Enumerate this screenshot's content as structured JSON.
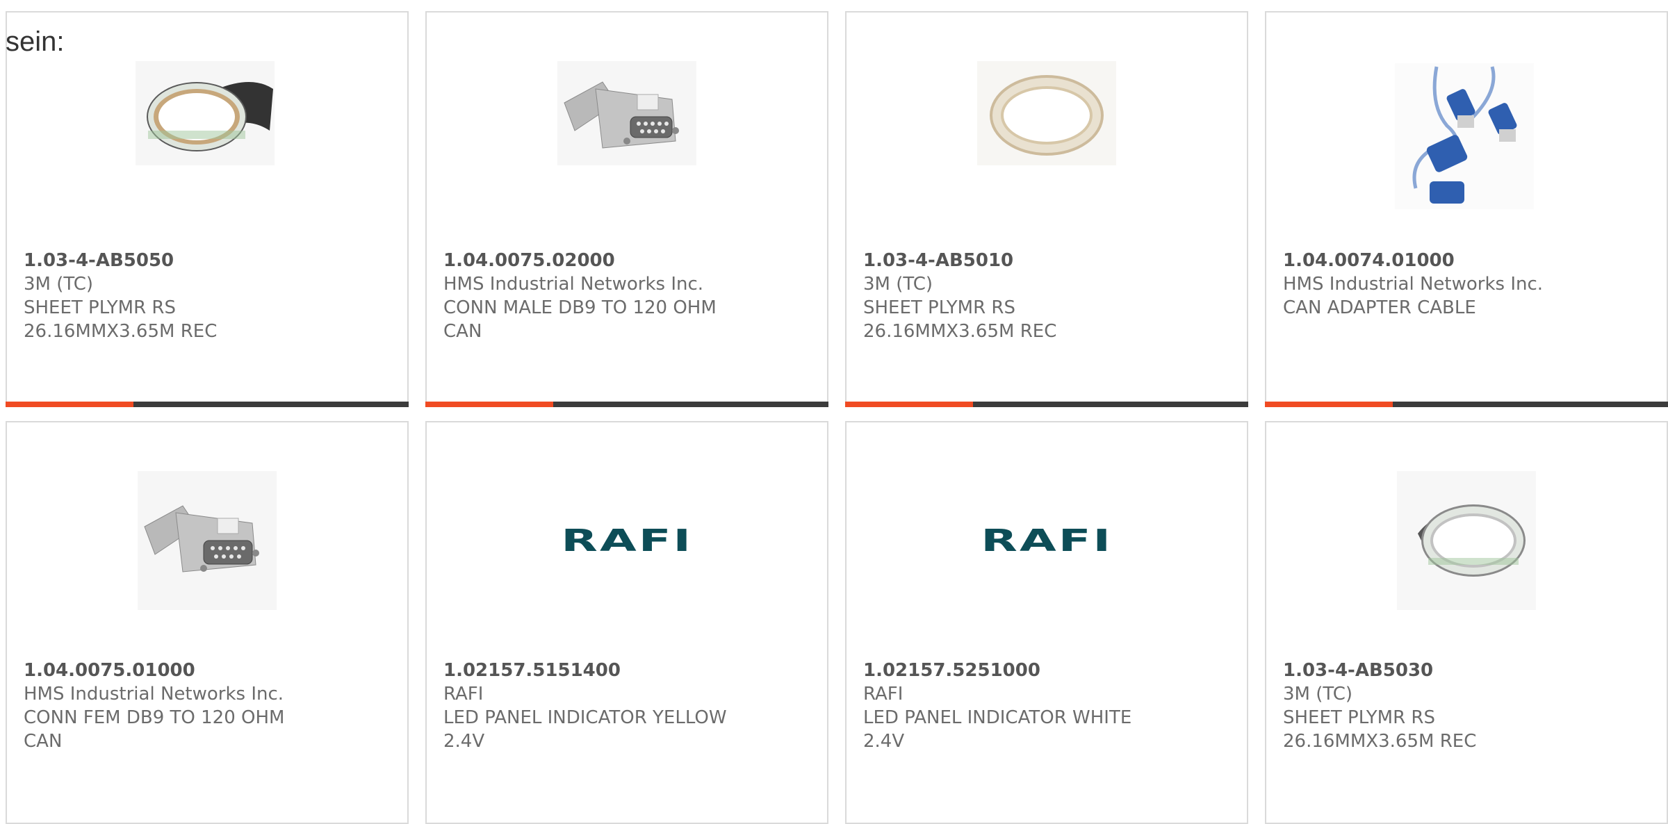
{
  "intro_text": "sein:",
  "colors": {
    "accent": "#f04b23",
    "bar": "#3c3c3c",
    "border": "#dadada",
    "rafi": "#0d4d57"
  },
  "products": [
    {
      "part_number": "1.03-4-AB5050",
      "manufacturer": "3M (TC)",
      "description": "SHEET PLYMR RS\n26.16MMX3.65M REC",
      "image": "dark-tape-roll-icon"
    },
    {
      "part_number": "1.04.0075.02000",
      "manufacturer": "HMS Industrial Networks Inc.",
      "description": "CONN MALE DB9 TO 120 OHM\nCAN",
      "image": "db9-connector-icon"
    },
    {
      "part_number": "1.03-4-AB5010",
      "manufacturer": "3M (TC)",
      "description": "SHEET PLYMR RS\n26.16MMX3.65M REC",
      "image": "clear-tape-roll-icon"
    },
    {
      "part_number": "1.04.0074.01000",
      "manufacturer": "HMS Industrial Networks Inc.",
      "description": "CAN ADAPTER CABLE",
      "image": "can-adapter-cable-icon"
    },
    {
      "part_number": "1.04.0075.01000",
      "manufacturer": "HMS Industrial Networks Inc.",
      "description": "CONN FEM DB9 TO 120 OHM\nCAN",
      "image": "db9-connector-icon"
    },
    {
      "part_number": "1.02157.5151400",
      "manufacturer": "RAFI",
      "description": "LED PANEL INDICATOR YELLOW\n2.4V",
      "image": "rafi-logo",
      "logo_text": "RAFI"
    },
    {
      "part_number": "1.02157.5251000",
      "manufacturer": "RAFI",
      "description": "LED PANEL INDICATOR WHITE\n2.4V",
      "image": "rafi-logo",
      "logo_text": "RAFI"
    },
    {
      "part_number": "1.03-4-AB5030",
      "manufacturer": "3M (TC)",
      "description": "SHEET PLYMR RS\n26.16MMX3.65M REC",
      "image": "grey-tape-roll-icon"
    }
  ]
}
